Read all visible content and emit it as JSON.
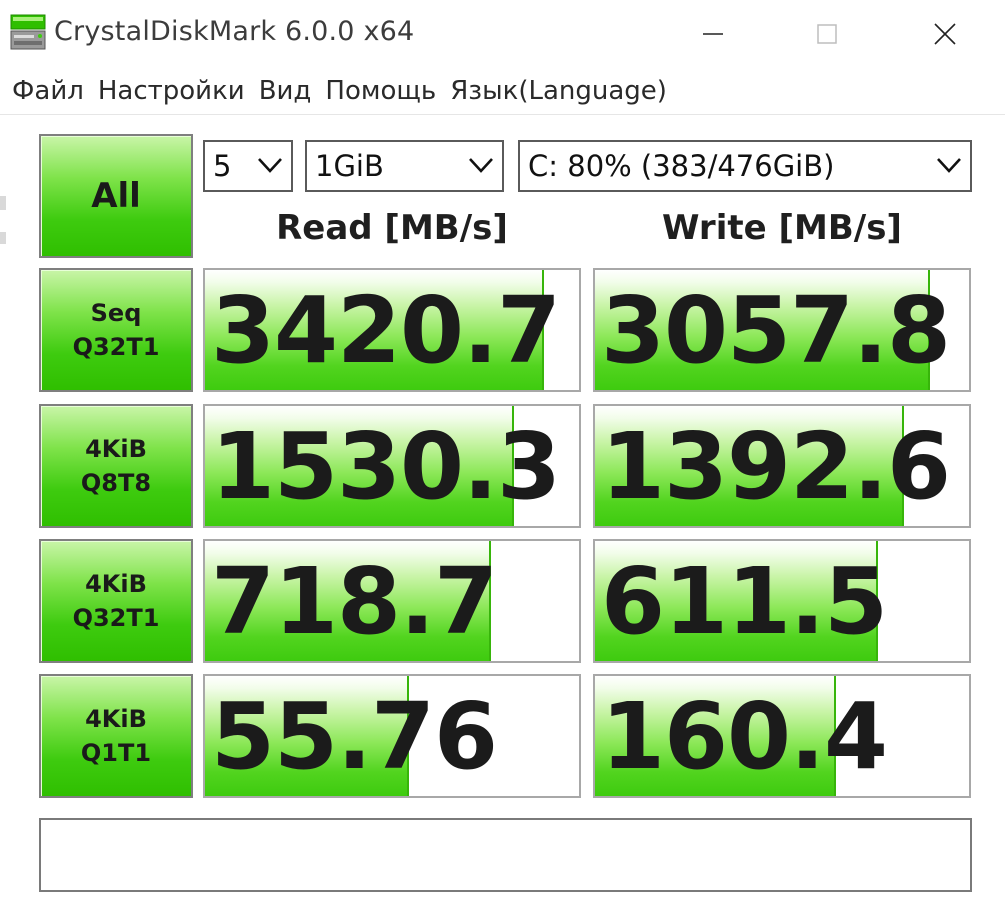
{
  "window": {
    "title": "CrystalDiskMark 6.0.0 x64"
  },
  "menu": {
    "items": [
      "Файл",
      "Настройки",
      "Вид",
      "Помощь",
      "Язык(Language)"
    ]
  },
  "controls": {
    "all_button": "All",
    "count": "5",
    "size": "1GiB",
    "drive": "C: 80% (383/476GiB)"
  },
  "headers": {
    "read": "Read [MB/s]",
    "write": "Write [MB/s]"
  },
  "tests": [
    {
      "label_line1": "Seq",
      "label_line2": "Q32T1",
      "read": "3420.7",
      "write": "3057.8",
      "read_fill": 0.9,
      "write_fill": 0.89
    },
    {
      "label_line1": "4KiB",
      "label_line2": "Q8T8",
      "read": "1530.3",
      "write": "1392.6",
      "read_fill": 0.82,
      "write_fill": 0.82
    },
    {
      "label_line1": "4KiB",
      "label_line2": "Q32T1",
      "read": "718.7",
      "write": "611.5",
      "read_fill": 0.76,
      "write_fill": 0.75
    },
    {
      "label_line1": "4KiB",
      "label_line2": "Q1T1",
      "read": "55.76",
      "write": "160.4",
      "read_fill": 0.54,
      "write_fill": 0.64
    }
  ],
  "comment": "",
  "colors": {
    "accent_green": "#3ecb0f",
    "border_gray": "#a8a8a8"
  },
  "icons": {
    "app": "disk-icon",
    "minimize": "minimize-icon",
    "maximize": "maximize-icon",
    "close": "close-icon",
    "dropdown": "chevron-down-icon"
  }
}
